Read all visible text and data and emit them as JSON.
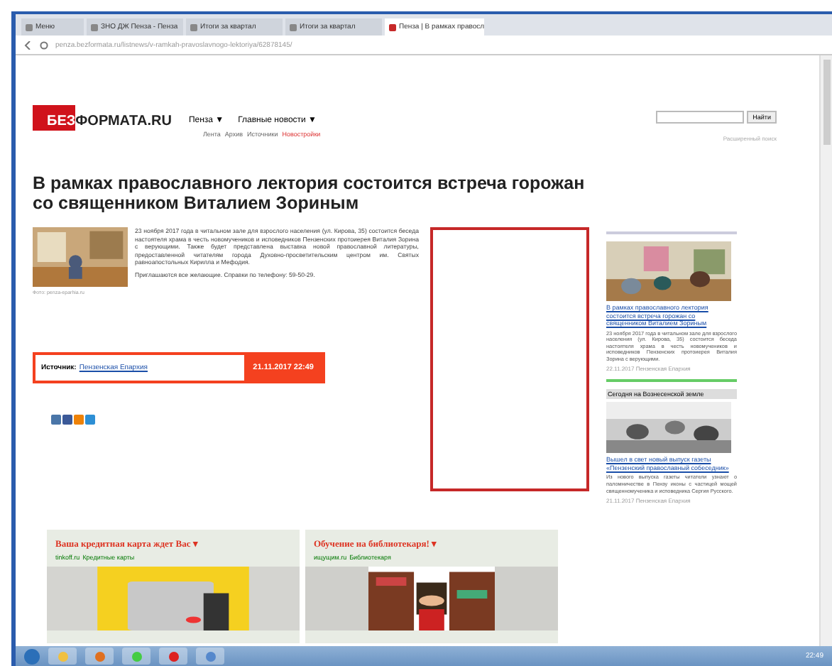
{
  "browser": {
    "tabs": [
      {
        "label": "Меню",
        "selected": false
      },
      {
        "label": "ЗНО ДЖ Пенза - Пенза",
        "selected": false
      },
      {
        "label": "Итоги за квартал",
        "selected": false
      },
      {
        "label": "Итоги за квартал",
        "selected": false
      },
      {
        "label": "Пенза | В рамках правосл",
        "selected": true
      }
    ],
    "url": "penza.bezformata.ru/listnews/v-ramkah-pravoslavnogo-lektoriya/62878145/"
  },
  "site": {
    "logo_accent": "БЕЗ",
    "logo_rest": "ФОРМАТА.RU",
    "nav": [
      "Пенза ▼",
      "Главные новости ▼"
    ],
    "subnav": [
      {
        "label": "Лента",
        "highlight": false
      },
      {
        "label": "Архив",
        "highlight": false
      },
      {
        "label": "Источники",
        "highlight": false
      },
      {
        "label": "Новостройки",
        "highlight": true
      }
    ],
    "search_button": "Найти",
    "search_hint": "Расширенный поиск"
  },
  "article": {
    "title": "В рамках православного лектория состоится встреча горожан со священником Виталием Зориным",
    "photo_caption": "Фото: penza-eparhia.ru",
    "paragraphs": [
      "23 ноября 2017 года в читальном зале для взрослого населения (ул. Кирова, 35) состоится беседа настоятеля храма в честь новомучеников и исповедников Пензенских протоиерея Виталия Зорина с верующими. Также будет представлена выставка новой православной литературы, предоставленной читателям города Духовно-просветительским центром им. Святых равноапостольных Кирилла и Мефодия.",
      "Приглашаются все желающие. Справки по телефону: 59-50-29."
    ],
    "source_label": "Источник:",
    "source": "Пензенская Епархия",
    "date": "21.11.2017 22:49"
  },
  "sidebar": [
    {
      "title": "В рамках православного лектория состоится встреча горожан со священником Виталием Зориным",
      "text": "23 ноября 2017 года в читальном зале для взрослого населения (ул. Кирова, 35) состоится беседа настоятеля храма в честь новомучеников и исповедников Пензенских протоиерея Виталия Зорина с верующими.",
      "meta": "22.11.2017 Пензенская Епархия"
    },
    {
      "caption": "Сегодня на Вознесенской земле",
      "title": "Вышел в свет новый выпуск газеты «Пензенский православный собеседник»",
      "text": "Из нового выпуска газеты читатели узнают о паломничестве в Пензу иконы с частицей мощей священномученика и исповедника Сергия Русского.",
      "meta": "21.11.2017 Пензенская Епархия"
    }
  ],
  "ad_menu_glyph": "▾",
  "ads": [
    {
      "title": "Ваша кредитная карта ждет Вас",
      "domain": "tinkoff.ru",
      "topic": "Кредитные карты"
    },
    {
      "title": "Обучение на библиотекаря!",
      "domain": "ищущим.ru",
      "topic": "Библиотекаря"
    }
  ],
  "taskbar": {
    "time": "22:49"
  }
}
